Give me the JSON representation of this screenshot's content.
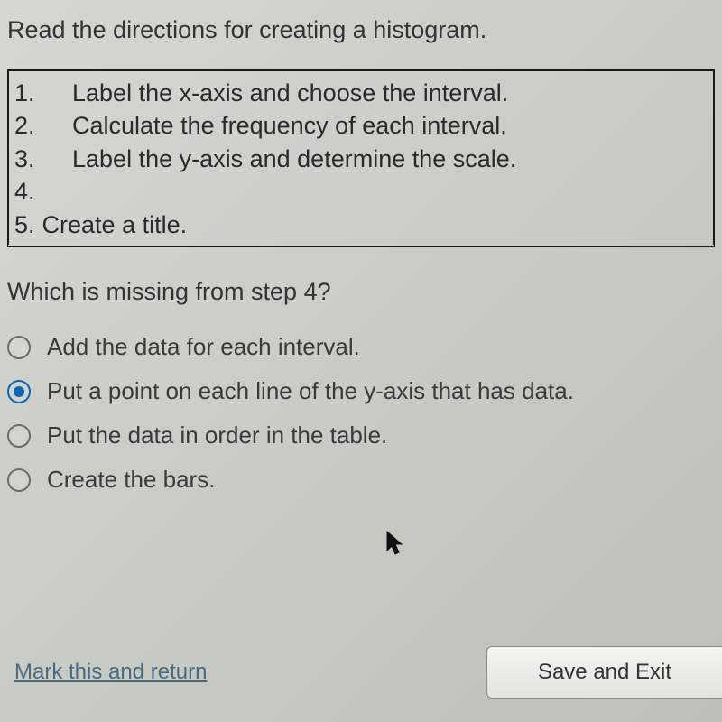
{
  "instruction": "Read the directions for creating a histogram.",
  "steps": [
    {
      "num": "1.",
      "text": "Label the x-axis and choose the interval."
    },
    {
      "num": "2.",
      "text": "Calculate the frequency of each interval."
    },
    {
      "num": "3.",
      "text": "Label the y-axis and determine the scale."
    },
    {
      "num": "4.",
      "text": ""
    },
    {
      "num": "5.",
      "text": "Create a title."
    }
  ],
  "question": "Which is missing from step 4?",
  "options": [
    {
      "label": "Add the data for each interval.",
      "selected": false
    },
    {
      "label": "Put a point on each line of the y-axis that has data.",
      "selected": true
    },
    {
      "label": "Put the data in order in the table.",
      "selected": false
    },
    {
      "label": "Create the bars.",
      "selected": false
    }
  ],
  "footer": {
    "mark_link": "Mark this and return",
    "save_button": "Save and Exit"
  }
}
